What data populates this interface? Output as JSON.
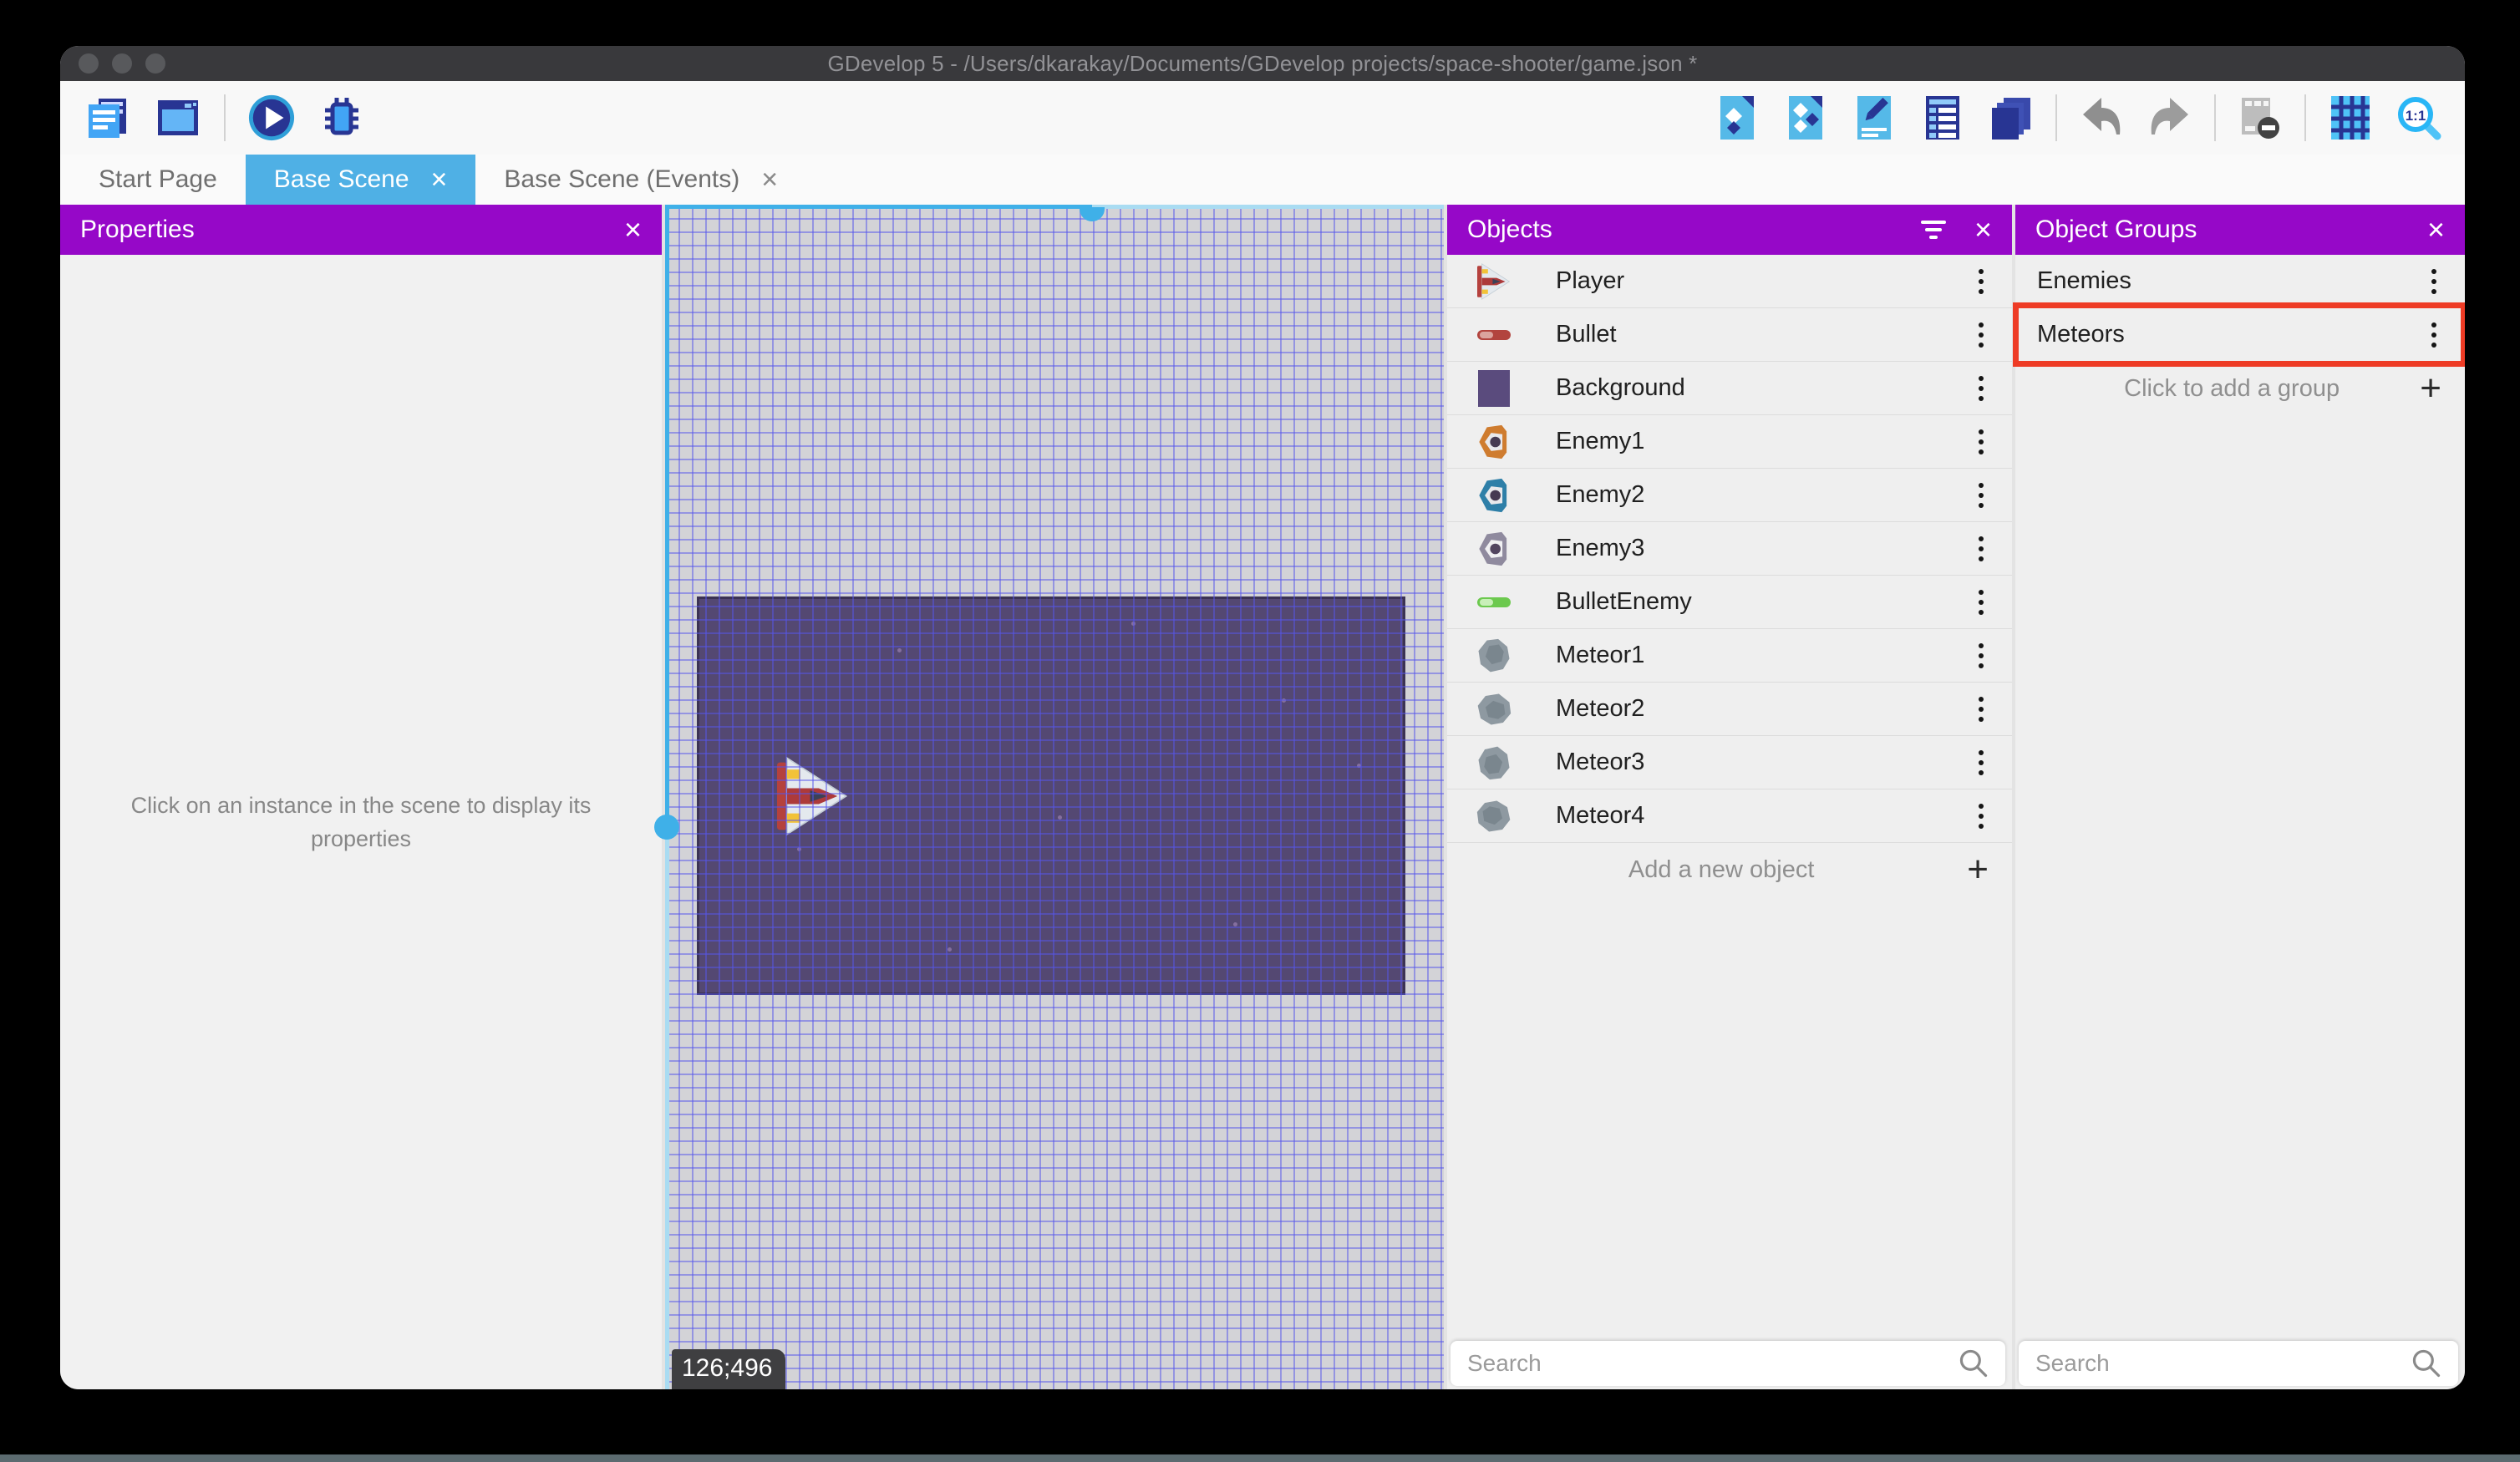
{
  "window": {
    "title": "GDevelop 5 - /Users/dkarakay/Documents/GDevelop projects/space-shooter/game.json *"
  },
  "toolbar": {
    "left_icons": [
      "project-manager",
      "scene-editor",
      "preview-play",
      "debug"
    ],
    "right_icons": [
      "add-object",
      "edit-object-groups",
      "edit-scene-properties",
      "open-instances-list",
      "open-layers",
      "undo",
      "redo",
      "toggle-mask",
      "toggle-grid",
      "zoom-1-1"
    ]
  },
  "tabs": [
    {
      "label": "Start Page",
      "active": false
    },
    {
      "label": "Base Scene",
      "active": true
    },
    {
      "label": "Base Scene (Events)",
      "active": false
    }
  ],
  "properties_panel": {
    "title": "Properties",
    "empty_message": "Click on an instance in the scene to display its properties"
  },
  "scene": {
    "coordinate_label": "126;496"
  },
  "objects_panel": {
    "title": "Objects",
    "items": [
      {
        "name": "Player"
      },
      {
        "name": "Bullet"
      },
      {
        "name": "Background"
      },
      {
        "name": "Enemy1"
      },
      {
        "name": "Enemy2"
      },
      {
        "name": "Enemy3"
      },
      {
        "name": "BulletEnemy"
      },
      {
        "name": "Meteor1"
      },
      {
        "name": "Meteor2"
      },
      {
        "name": "Meteor3"
      },
      {
        "name": "Meteor4"
      }
    ],
    "add_label": "Add a new object",
    "search_placeholder": "Search"
  },
  "groups_panel": {
    "title": "Object Groups",
    "items": [
      {
        "name": "Enemies"
      },
      {
        "name": "Meteors"
      }
    ],
    "highlighted_item": "Meteors",
    "add_label": "Click to add a group",
    "search_placeholder": "Search"
  },
  "colors": {
    "accent_blue": "#4FB0E5",
    "panel_header_purple": "#9608C8",
    "selection_blue": "#3FB0E8",
    "highlight_red": "#EE3B25",
    "canvas_background": "#544872"
  }
}
